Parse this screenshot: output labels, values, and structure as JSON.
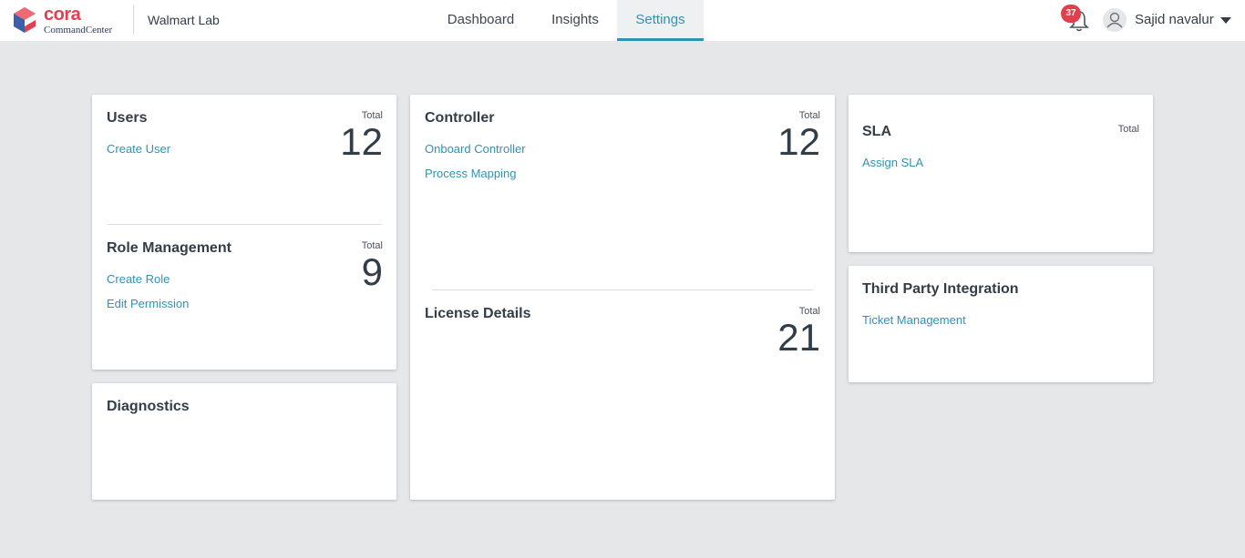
{
  "header": {
    "logo_word": "cora",
    "logo_sub": "CommandCenter",
    "tenant": "Walmart Lab",
    "tabs": [
      {
        "label": "Dashboard",
        "active": false
      },
      {
        "label": "Insights",
        "active": false
      },
      {
        "label": "Settings",
        "active": true
      }
    ],
    "notifications_count": "37",
    "user_name": "Sajid navalur",
    "accent_color": "#2f93b3",
    "badge_color": "#e0404a"
  },
  "cards": {
    "users": {
      "title": "Users",
      "total_label": "Total",
      "total": "12",
      "links": [
        "Create User"
      ]
    },
    "role_management": {
      "title": "Role Management",
      "total_label": "Total",
      "total": "9",
      "links": [
        "Create Role",
        "Edit Permission"
      ]
    },
    "diagnostics": {
      "title": "Diagnostics"
    },
    "controller": {
      "title": "Controller",
      "total_label": "Total",
      "total": "12",
      "links": [
        "Onboard Controller",
        "Process Mapping"
      ]
    },
    "license_details": {
      "title": "License Details",
      "total_label": "Total",
      "total": "21"
    },
    "sla": {
      "title": "SLA",
      "total_label": "Total",
      "links": [
        "Assign SLA"
      ]
    },
    "third_party": {
      "title": "Third Party Integration",
      "links": [
        "Ticket Management"
      ]
    }
  }
}
